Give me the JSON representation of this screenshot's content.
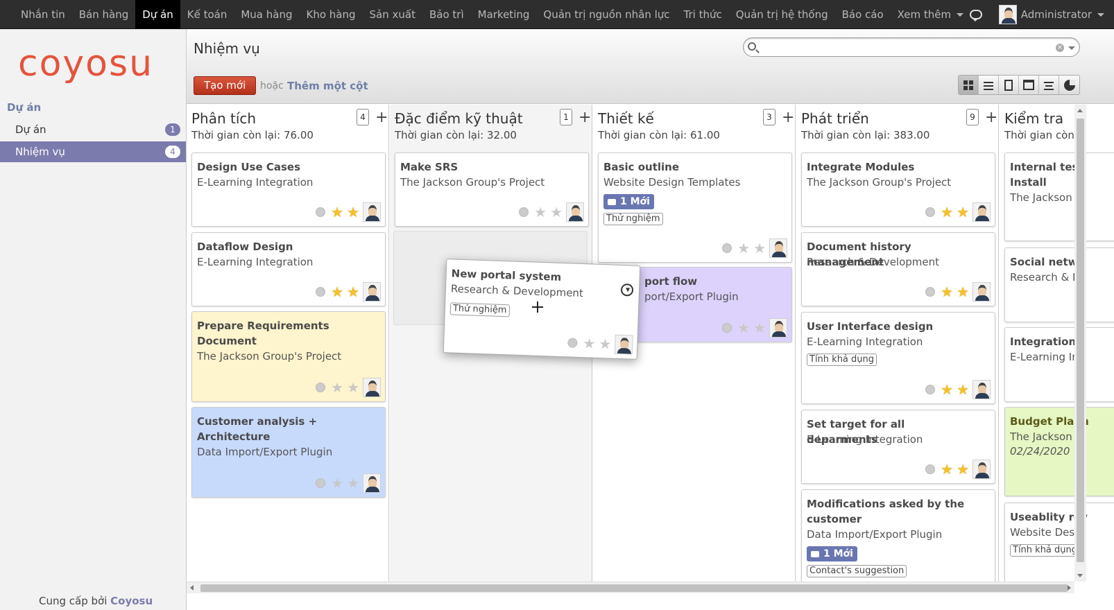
{
  "topbar": {
    "menu": [
      {
        "label": "Nhắn tin"
      },
      {
        "label": "Bán hàng"
      },
      {
        "label": "Dự án"
      },
      {
        "label": "Kế toán"
      },
      {
        "label": "Mua hàng"
      },
      {
        "label": "Kho hàng"
      },
      {
        "label": "Sản xuất"
      },
      {
        "label": "Bảo trì"
      },
      {
        "label": "Marketing"
      },
      {
        "label": "Quản trị nguồn nhân lực"
      },
      {
        "label": "Tri thức"
      },
      {
        "label": "Quản trị hệ thống"
      },
      {
        "label": "Báo cáo"
      },
      {
        "label": "Xem thêm"
      }
    ],
    "active_menu": "Dự án",
    "user": "Administrator"
  },
  "sidebar": {
    "logo": "coyosu",
    "section": "Dự án",
    "items": [
      {
        "label": "Dự án",
        "count": "1"
      },
      {
        "label": "Nhiệm vụ",
        "count": "4"
      }
    ],
    "footer_prefix": "Cung cấp bởi",
    "footer_brand": "Coyosu"
  },
  "header": {
    "title": "Nhiệm vụ",
    "search_value": "",
    "create_label": "Tạo mới",
    "or_label": "hoặc",
    "add_column_label": "Thêm một cột"
  },
  "views": [
    "kanban",
    "list",
    "form",
    "calendar",
    "gantt",
    "graph"
  ],
  "columns": [
    {
      "title": "Phân tích",
      "count": "4",
      "remaining": "Thời gian còn lại: 76.00",
      "cards": [
        {
          "title": "Design Use Cases",
          "project": "E-Learning Integration",
          "stars": 2
        },
        {
          "title": "Dataflow Design",
          "project": "E-Learning Integration",
          "stars": 2
        },
        {
          "title": "Prepare Requirements Document",
          "project": "The Jackson Group's Project",
          "stars": 0
        },
        {
          "title": "Customer analysis + Architecture",
          "project": "Data Import/Export Plugin",
          "stars": 0
        }
      ]
    },
    {
      "title": "Đặc điểm kỹ thuật",
      "count": "1",
      "remaining": "Thời gian còn lại: 32.00",
      "cards": [
        {
          "title": "Make SRS",
          "project": "The Jackson Group's Project",
          "stars": 0
        }
      ]
    },
    {
      "title": "Thiết kế",
      "count": "3",
      "remaining": "Thời gian còn lại: 61.00",
      "cards": [
        {
          "title": "Basic outline",
          "project": "Website Design Templates",
          "badge": "1 Mới",
          "tag": "Thử nghiệm",
          "stars": 0
        },
        {
          "title": "port flow",
          "project": "port/Export Plugin",
          "stars": 0
        }
      ]
    },
    {
      "title": "Phát triển",
      "count": "9",
      "remaining": "Thời gian còn lại: 383.00",
      "cards": [
        {
          "title": "Integrate Modules",
          "project": "The Jackson Group's Project",
          "stars": 2
        },
        {
          "title": "Document history management",
          "project": "Research & Development",
          "stars": 2
        },
        {
          "title": "User Interface design",
          "project": "E-Learning Integration",
          "tag": "Tính khả dụng",
          "stars": 2
        },
        {
          "title": "Set target for all deparments",
          "project": "E-Learning Integration",
          "stars": 2
        },
        {
          "title": "Modifications asked by the customer",
          "project": "Data Import/Export Plugin",
          "badge": "1 Mới",
          "tag": "Contact's suggestion"
        }
      ]
    },
    {
      "title": "Kiểm tra",
      "remaining": "Thời gian còn",
      "cards": [
        {
          "title_l1": "Internal testi",
          "title_l2": "Install",
          "project": "The Jackson"
        },
        {
          "title": "Social netwo",
          "project": "Research & D"
        },
        {
          "title": "Integration o",
          "project": "E-Learning In"
        },
        {
          "title": "Budget Plann",
          "project": "The Jackson",
          "date": "02/24/2020"
        },
        {
          "title": "Useablity rev",
          "project": "Website Desi",
          "tag": "Tính khả dụng"
        }
      ]
    }
  ],
  "dragging_card": {
    "title": "New portal system",
    "project": "Research & Development",
    "tag": "Thử nghiệm",
    "stars": 0
  }
}
